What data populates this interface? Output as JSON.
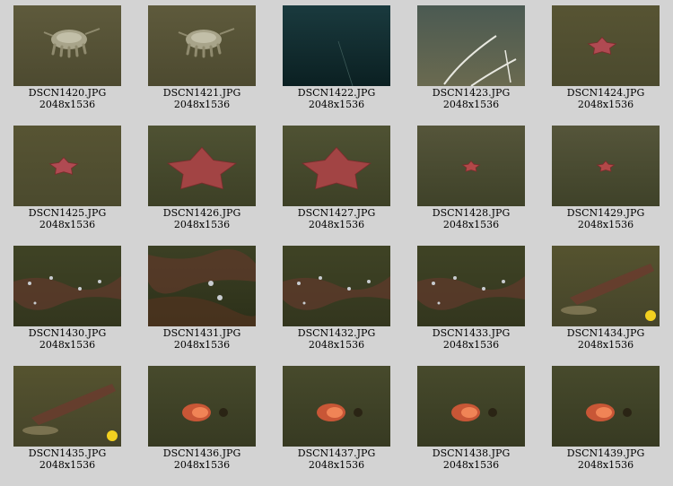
{
  "gallery": {
    "items": [
      {
        "filename": "DSCN1420.JPG",
        "dimensions": "2048x1536",
        "scene": "sea-pig"
      },
      {
        "filename": "DSCN1421.JPG",
        "dimensions": "2048x1536",
        "scene": "sea-pig"
      },
      {
        "filename": "DSCN1422.JPG",
        "dimensions": "2048x1536",
        "scene": "dark-water"
      },
      {
        "filename": "DSCN1423.JPG",
        "dimensions": "2048x1536",
        "scene": "whip-coral"
      },
      {
        "filename": "DSCN1424.JPG",
        "dimensions": "2048x1536",
        "scene": "starfish-small"
      },
      {
        "filename": "DSCN1425.JPG",
        "dimensions": "2048x1536",
        "scene": "starfish-small"
      },
      {
        "filename": "DSCN1426.JPG",
        "dimensions": "2048x1536",
        "scene": "starfish-large"
      },
      {
        "filename": "DSCN1427.JPG",
        "dimensions": "2048x1536",
        "scene": "starfish-large"
      },
      {
        "filename": "DSCN1428.JPG",
        "dimensions": "2048x1536",
        "scene": "starfish-tiny"
      },
      {
        "filename": "DSCN1429.JPG",
        "dimensions": "2048x1536",
        "scene": "starfish-tiny"
      },
      {
        "filename": "DSCN1430.JPG",
        "dimensions": "2048x1536",
        "scene": "reef-ridge"
      },
      {
        "filename": "DSCN1431.JPG",
        "dimensions": "2048x1536",
        "scene": "reef-closeup"
      },
      {
        "filename": "DSCN1432.JPG",
        "dimensions": "2048x1536",
        "scene": "reef-ridge"
      },
      {
        "filename": "DSCN1433.JPG",
        "dimensions": "2048x1536",
        "scene": "reef-ridge"
      },
      {
        "filename": "DSCN1434.JPG",
        "dimensions": "2048x1536",
        "scene": "reef-yellow"
      },
      {
        "filename": "DSCN1435.JPG",
        "dimensions": "2048x1536",
        "scene": "reef-yellow"
      },
      {
        "filename": "DSCN1436.JPG",
        "dimensions": "2048x1536",
        "scene": "red-cloud"
      },
      {
        "filename": "DSCN1437.JPG",
        "dimensions": "2048x1536",
        "scene": "red-cloud"
      },
      {
        "filename": "DSCN1438.JPG",
        "dimensions": "2048x1536",
        "scene": "red-cloud"
      },
      {
        "filename": "DSCN1439.JPG",
        "dimensions": "2048x1536",
        "scene": "red-cloud"
      }
    ]
  },
  "colors": {
    "page_background": "#d3d3d3",
    "seafloor": "#4a4a2e",
    "starfish": "#b24848",
    "deep_water": "#0f2a2c"
  }
}
